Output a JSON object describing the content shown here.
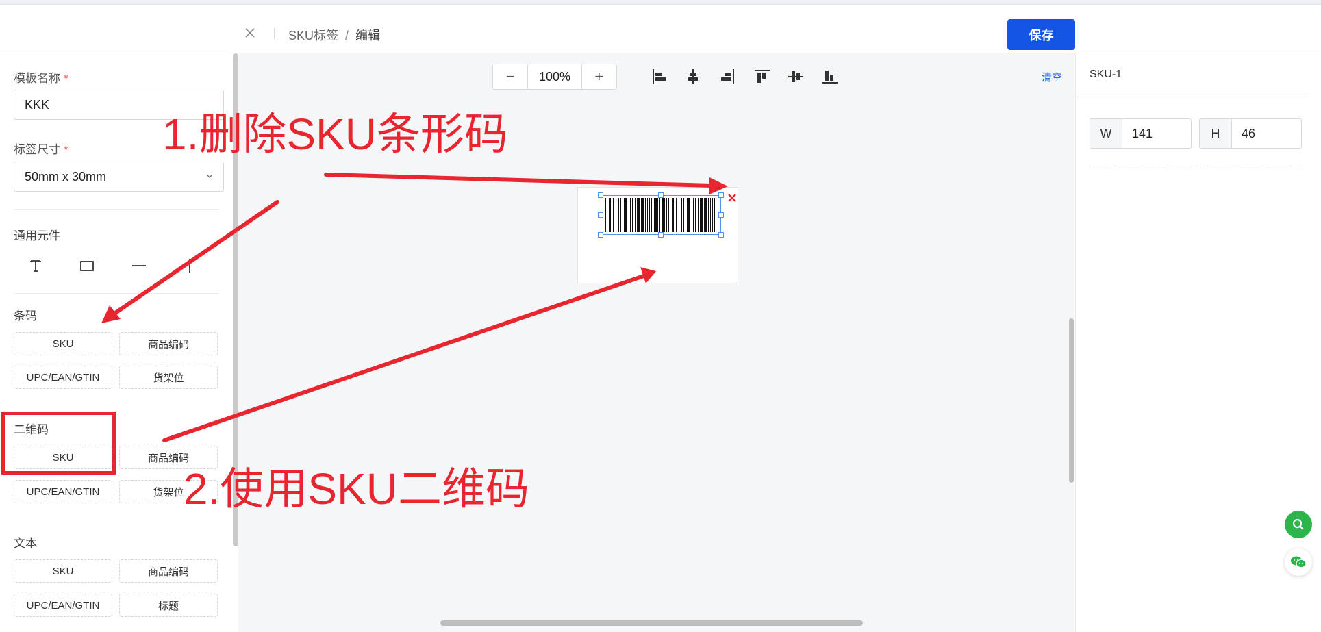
{
  "header": {
    "breadcrumb_root": "SKU标签",
    "breadcrumb_sep": "/",
    "breadcrumb_current": "编辑",
    "save_label": "保存"
  },
  "left_panel": {
    "template_name_label": "模板名称",
    "template_name_value": "KKK",
    "size_label": "标签尺寸",
    "size_value": "50mm x 30mm",
    "required_mark": "*",
    "sections": {
      "general": "通用元件",
      "barcode": "条码",
      "qrcode": "二维码",
      "text": "文本"
    },
    "general_tools": [
      "text-tool",
      "rectangle-tool",
      "horizontal-line-tool",
      "vertical-line-tool"
    ],
    "barcode_items": [
      "SKU",
      "商品编码",
      "UPC/EAN/GTIN",
      "货架位"
    ],
    "qrcode_items": [
      "SKU",
      "商品编码",
      "UPC/EAN/GTIN",
      "货架位"
    ],
    "text_items": [
      "SKU",
      "商品编码",
      "UPC/EAN/GTIN",
      "标题"
    ]
  },
  "canvas": {
    "zoom_level": "100%",
    "zoom_out": "−",
    "zoom_in": "+",
    "clear_label": "清空",
    "align_icons": [
      "align-left-icon",
      "align-center-horizontal-icon",
      "align-right-icon",
      "align-top-icon",
      "align-middle-vertical-icon",
      "align-bottom-icon"
    ]
  },
  "right_panel": {
    "element_name": "SKU-1",
    "width_label": "W",
    "width_value": "141",
    "height_label": "H",
    "height_value": "46"
  },
  "annotations": {
    "step1": "1.删除SKU条形码",
    "step2": "2.使用SKU二维码"
  },
  "colors": {
    "primary": "#1555e6",
    "annotation_red": "#e8262f",
    "selection_blue": "#5b8def",
    "fab_green": "#2bb54a"
  }
}
